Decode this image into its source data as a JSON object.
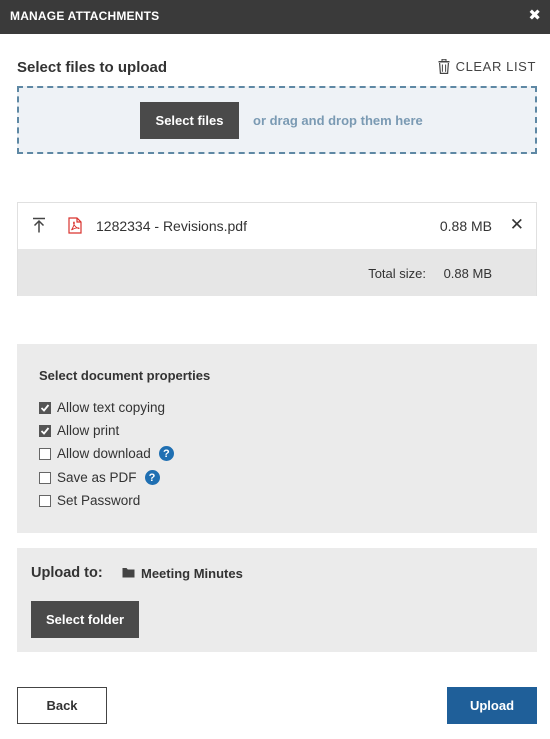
{
  "dialog": {
    "title": "MANAGE ATTACHMENTS",
    "close_symbol": "✖"
  },
  "upload": {
    "heading": "Select files to upload",
    "clear_list_label": "CLEAR LIST",
    "select_files_label": "Select files",
    "drop_hint": "or drag and drop them here"
  },
  "files": [
    {
      "name": "1282334 - Revisions.pdf",
      "size": "0.88 MB"
    }
  ],
  "total": {
    "label": "Total size:",
    "value": "0.88 MB"
  },
  "properties": {
    "heading": "Select document properties",
    "options": [
      {
        "label": "Allow text copying",
        "checked": true,
        "help": false
      },
      {
        "label": "Allow print",
        "checked": true,
        "help": false
      },
      {
        "label": "Allow download",
        "checked": false,
        "help": true
      },
      {
        "label": "Save as PDF",
        "checked": false,
        "help": true
      },
      {
        "label": "Set Password",
        "checked": false,
        "help": false
      }
    ]
  },
  "destination": {
    "label": "Upload to:",
    "folder_name": "Meeting Minutes",
    "select_folder_label": "Select folder"
  },
  "footer": {
    "back_label": "Back",
    "upload_label": "Upload"
  },
  "icons": {
    "help_glyph": "?",
    "remove_glyph": "✕"
  },
  "colors": {
    "titlebar": "#3a3a3a",
    "accent": "#1f5f99",
    "help": "#1f6fb2",
    "pdf": "#d9332e"
  }
}
